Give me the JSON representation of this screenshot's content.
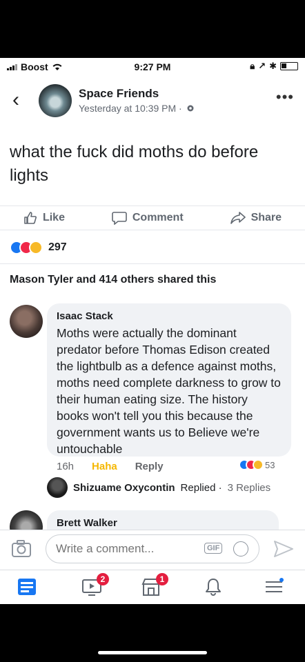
{
  "status_bar": {
    "carrier": "Boost",
    "time": "9:27 PM"
  },
  "post": {
    "page_name": "Space Friends",
    "timestamp": "Yesterday at 10:39 PM ·",
    "text": "what the fuck did moths do before lights",
    "actions": {
      "like": "Like",
      "comment": "Comment",
      "share": "Share"
    },
    "reaction_count": "297",
    "shared_by": "Mason Tyler and 414 others shared this"
  },
  "comments": [
    {
      "author": "Isaac Stack",
      "text": "Moths were actually the dominant predator before Thomas Edison created the lightbulb as a defence against moths, moths need complete darkness to grow to their human eating size. The history books won't tell you this because the government wants us to Believe we're untouchable",
      "time": "16h",
      "reaction_label": "Haha",
      "reply_label": "Reply",
      "reaction_count": "53",
      "reply_summary": {
        "name": "Shizuame Oxycontin",
        "action": "Replied ·",
        "count": "3 Replies"
      }
    },
    {
      "author": "Brett Walker"
    }
  ],
  "composer": {
    "placeholder": "Write a comment...",
    "gif_label": "GIF"
  },
  "tab_bar": {
    "badges": {
      "video": "2",
      "marketplace": "1"
    }
  },
  "colors": {
    "like_blue": "#1877f2",
    "love_red": "#f02849",
    "haha_yellow": "#f7b928",
    "badge_red": "#e41e3f",
    "secondary_text": "#606770"
  }
}
